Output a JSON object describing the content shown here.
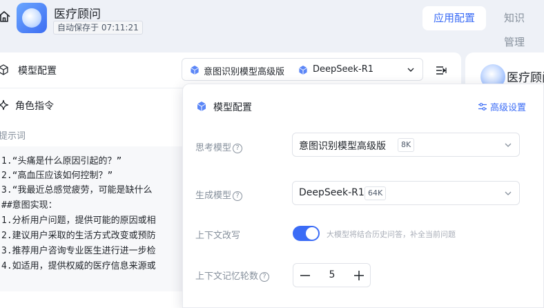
{
  "header": {
    "app_title": "医疗顾问",
    "autosave": "自动保存于 07:11:21",
    "tabs": [
      {
        "label": "应用配置",
        "active": true
      },
      {
        "label": "知识管理",
        "active": false
      }
    ]
  },
  "left": {
    "model_row_label": "模型配置",
    "model_select": {
      "intent_model": "意图识别模型高级版",
      "gen_model": "DeepSeek-R1"
    },
    "role_label": "角色指令",
    "prompt_label": "提示词",
    "prompt_lines": [
      "1.“头痛是什么原因引起的？”",
      "2.“高血压应该如何控制？”",
      "3.“我最近总感觉疲劳，可能是缺什么",
      "##意图实现：",
      "1.分析用户问题，提供可能的原因或相",
      "2.建议用户采取的生活方式改变或预防",
      "3.推荐用户咨询专业医生进行进一步检",
      "4.如适用，提供权威的医疗信息来源或"
    ]
  },
  "preview": {
    "title": "医疗顾问"
  },
  "popover": {
    "title": "模型配置",
    "advanced": "高级设置",
    "think_label": "思考模型",
    "think_value": "意图识别模型高级版",
    "think_tag": "8K",
    "gen_label": "生成模型",
    "gen_value": "DeepSeek-R1",
    "gen_tag": "64K",
    "context_rewrite_label": "上下文改写",
    "context_rewrite_on": true,
    "context_rewrite_desc": "大模型将结合历史问答，补全当前问题",
    "memory_rounds_label": "上下文记忆轮数",
    "memory_rounds": "5"
  },
  "colors": {
    "accent": "#3b6cf6",
    "background": "#eef1f7",
    "muted": "#86909c"
  },
  "icons": [
    "home-icon",
    "app-logo",
    "cube-icon",
    "chevron-down-icon",
    "collapse-panel-icon",
    "sparkle-icon",
    "sliders-icon",
    "help-icon",
    "minus-icon",
    "plus-icon"
  ]
}
